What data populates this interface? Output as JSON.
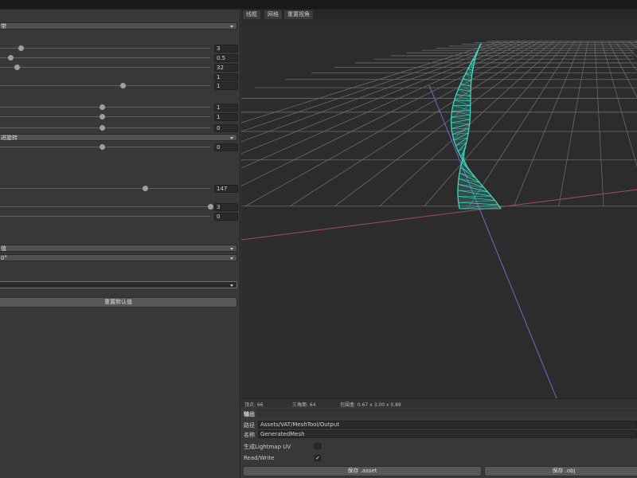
{
  "inspector": {
    "dropdown_1": "带",
    "sliders": [
      {
        "id": "s1",
        "value": "3",
        "fraction": 0.1
      },
      {
        "id": "s2",
        "value": "0.5",
        "fraction": 0.05
      },
      {
        "id": "s3",
        "value": "32",
        "fraction": 0.08
      },
      {
        "id": "s4",
        "value": "1",
        "fraction": null
      },
      {
        "id": "s5",
        "value": "1",
        "fraction": 0.585
      },
      {
        "id": "s6",
        "value": "1",
        "fraction": 0.485
      },
      {
        "id": "s7",
        "value": "1",
        "fraction": 0.485
      },
      {
        "id": "s8",
        "value": "0",
        "fraction": 0.485
      }
    ],
    "dropdown_2": "进旋转",
    "slider_after_dd2": {
      "value": "0",
      "fraction": 0.485
    },
    "slider_b1": {
      "value": "147",
      "fraction": 0.69
    },
    "slider_b2": {
      "value": "3",
      "fraction": 1.0
    },
    "slider_b3": {
      "value": "0",
      "fraction": null
    },
    "dropdown_3": "值",
    "dropdown_4": "0°",
    "dropdown_5": "",
    "reset_label": "重置默认值"
  },
  "viewport": {
    "tabs": [
      "线框",
      "网格",
      "重置视角"
    ],
    "grid_color": "#6b6b6b",
    "x_axis_color": "#a04f4f",
    "z_axis_color": "#6a6ac8",
    "mesh_color": "#3fe0c9"
  },
  "stats": {
    "vertices": "顶点: 66",
    "triangles": "三角面: 64",
    "bounds": "包围盒: 0.67 x 3.00 x 0.89"
  },
  "output": {
    "title": "输出",
    "path_label": "路径",
    "path_value": "Assets/VAT/MeshTool/Output",
    "name_label": "名称",
    "name_value": "GeneratedMesh",
    "lightmap_label": "生成Lightmap UV",
    "lightmap_checked": "",
    "readwrite_label": "Read/Write",
    "readwrite_checked": "✓",
    "save_asset": "保存 .asset",
    "save_obj": "保存 .obj"
  }
}
